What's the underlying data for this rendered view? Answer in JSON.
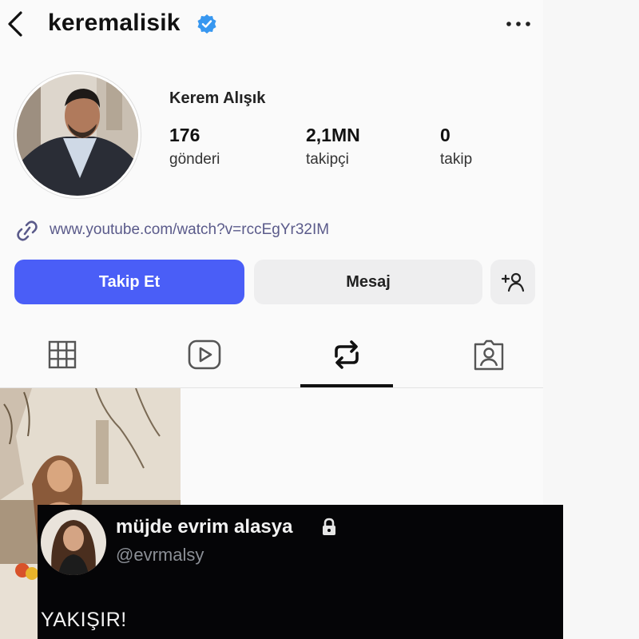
{
  "header": {
    "username": "keremalisik",
    "back_icon": "chevron-left-icon",
    "verified_icon": "verified-badge-icon",
    "more_icon": "more-horizontal-icon"
  },
  "profile": {
    "display_name": "Kerem Alışık",
    "stats": [
      {
        "value": "176",
        "label": "gönderi"
      },
      {
        "value": "2,1MN",
        "label": "takipçi"
      },
      {
        "value": "0",
        "label": "takip"
      }
    ],
    "link": "www.youtube.com/watch?v=rccEgYr32IM"
  },
  "actions": {
    "follow_label": "Takip Et",
    "message_label": "Mesaj",
    "add_user_icon": "add-user-icon"
  },
  "tabs": [
    {
      "name": "grid",
      "icon": "grid-icon",
      "active": false
    },
    {
      "name": "reels",
      "icon": "reels-icon",
      "active": false
    },
    {
      "name": "reposts",
      "icon": "repost-icon",
      "active": true
    },
    {
      "name": "tagged",
      "icon": "tagged-icon",
      "active": false
    }
  ],
  "tweet": {
    "name": "müjde evrim alasya",
    "handle": "@evrmalsy",
    "text": "YAKIŞIR!",
    "lock_icon": "lock-icon"
  },
  "colors": {
    "follow_button": "#4a5ef7",
    "secondary_button": "#eeeeef",
    "verified": "#3797f0",
    "tweet_bg": "#050507"
  }
}
